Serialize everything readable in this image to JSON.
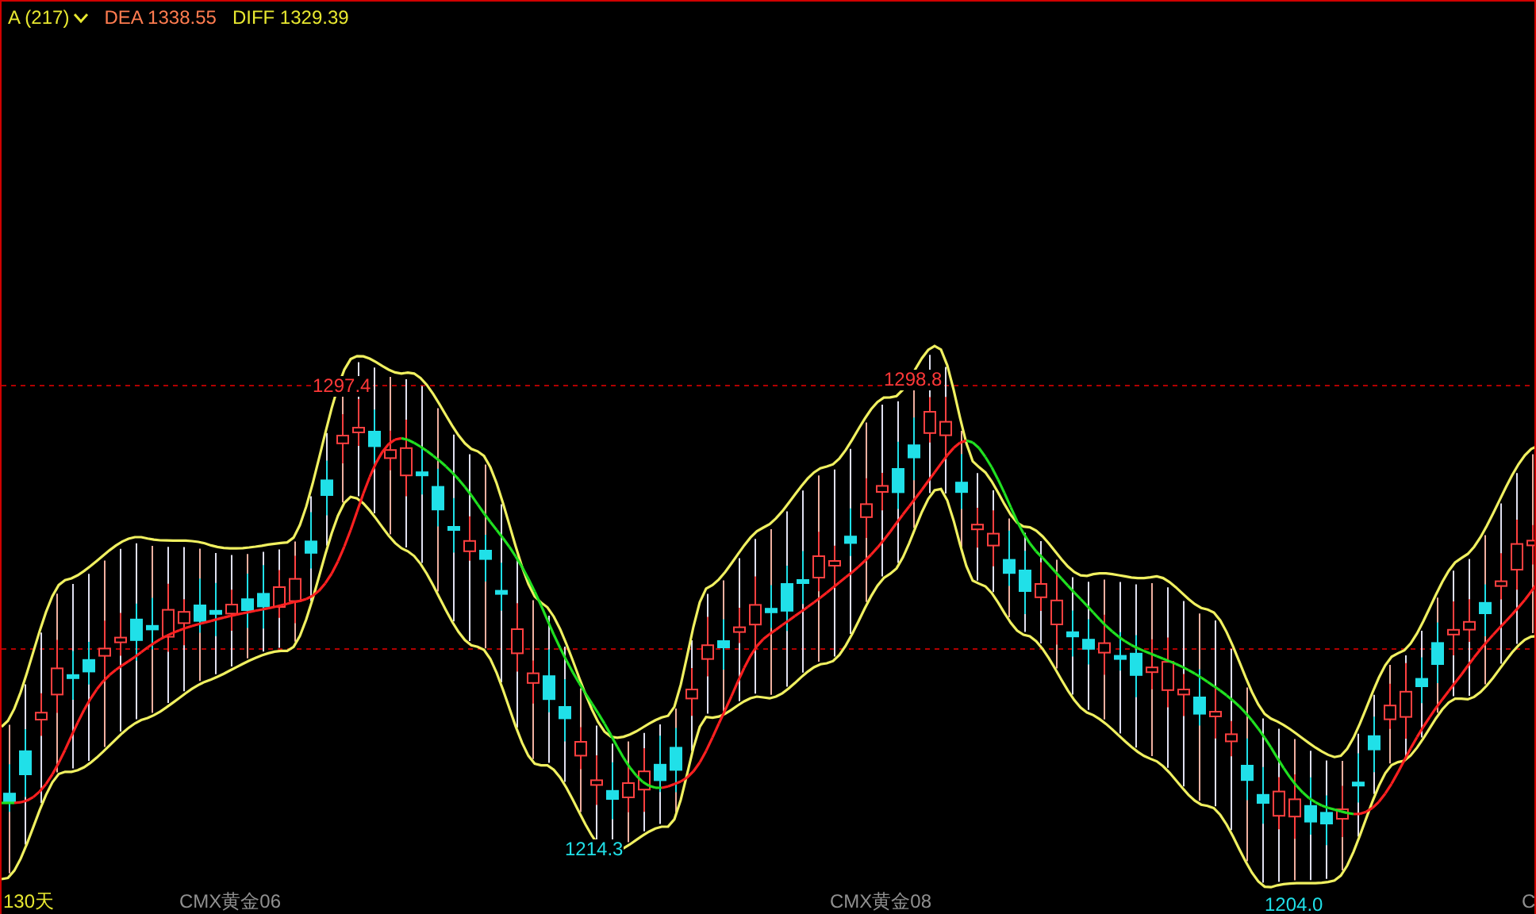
{
  "header": {
    "indicator": "A (217)",
    "dea": "DEA 1338.55",
    "diff": "DIFF 1329.39"
  },
  "price_labels": [
    {
      "text": "1297.4",
      "kind": "high"
    },
    {
      "text": "1298.8",
      "kind": "high"
    },
    {
      "text": "1214.3",
      "kind": "low"
    },
    {
      "text": "1204.0",
      "kind": "low"
    }
  ],
  "period": "130天",
  "contract_labels": [
    "CMX黄金06",
    "CMX黄金08",
    "C"
  ]
}
